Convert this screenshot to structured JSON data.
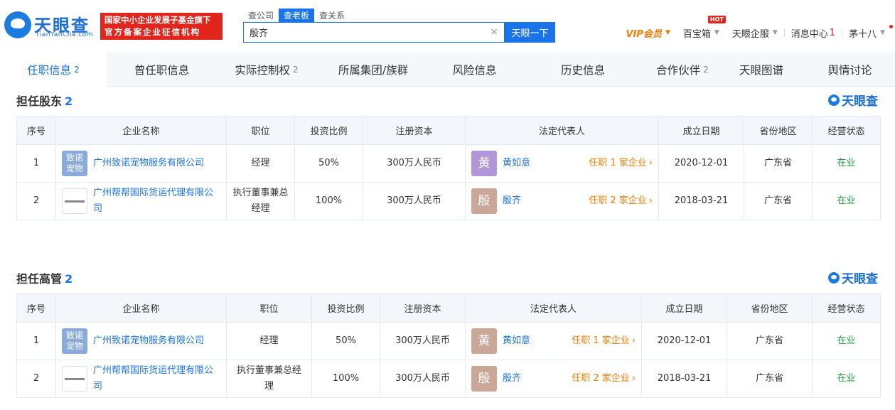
{
  "header": {
    "logo_text": "天眼查",
    "logo_sub": "TianYanCha.com",
    "slogan_line1": "国家中小企业发展子基金旗下",
    "slogan_line2": "官方备案企业征信机构",
    "search_tabs": [
      "查公司",
      "查老板",
      "查关系"
    ],
    "search_value": "殷齐",
    "search_button": "天眼一下",
    "nav": {
      "vip": "VIP会员",
      "baibaoxiang": "百宝箱",
      "hot": "HOT",
      "qiye": "天眼企服",
      "message": "消息中心",
      "message_count": "1",
      "user": "茅十八"
    }
  },
  "tabs": [
    {
      "label": "任职信息",
      "count": "2"
    },
    {
      "label": "曾任职信息",
      "count": ""
    },
    {
      "label": "实际控制权",
      "count": "2"
    },
    {
      "label": "所属集团/族群",
      "count": ""
    },
    {
      "label": "风险信息",
      "count": ""
    },
    {
      "label": "历史信息",
      "count": ""
    },
    {
      "label": "合作伙伴",
      "count": "2"
    },
    {
      "label": "天眼图谱",
      "count": ""
    },
    {
      "label": "舆情讨论",
      "count": ""
    }
  ],
  "brand": "天眼查",
  "shareholder": {
    "title": "担任股东",
    "count": "2",
    "columns": [
      "序号",
      "企业名称",
      "职位",
      "投资比例",
      "注册资本",
      "法定代表人",
      "成立日期",
      "省份地区",
      "经营状态"
    ],
    "rows": [
      {
        "no": "1",
        "logo": "致诺宠物",
        "company": "广州致诺宠物服务有限公司",
        "position": "经理",
        "ratio": "50%",
        "capital": "300万人民币",
        "avatar": "黄",
        "legal": "黄如意",
        "legal_role": "任职 1 家企业",
        "date": "2020-12-01",
        "region": "广东省",
        "status": "在业"
      },
      {
        "no": "2",
        "logo": "",
        "company": "广州帮帮国际货运代理有限公司",
        "position": "执行董事兼总经理",
        "ratio": "100%",
        "capital": "300万人民币",
        "avatar": "殷",
        "legal": "殷齐",
        "legal_role": "任职 2 家企业",
        "date": "2018-03-21",
        "region": "广东省",
        "status": "在业"
      }
    ]
  },
  "executive": {
    "title": "担任高管",
    "count": "2",
    "columns": [
      "序号",
      "企业名称",
      "职位",
      "投资比例",
      "注册资本",
      "法定代表人",
      "成立日期",
      "省份地区",
      "经营状态"
    ],
    "rows": [
      {
        "no": "1",
        "logo": "致诺宠物",
        "company": "广州致诺宠物服务有限公司",
        "position": "经理",
        "ratio": "50%",
        "capital": "300万人民币",
        "avatar": "黄",
        "legal": "黄如意",
        "legal_role": "任职 1 家企业",
        "date": "2020-12-01",
        "region": "广东省",
        "status": "在业"
      },
      {
        "no": "2",
        "logo": "",
        "company": "广州帮帮国际货运代理有限公司",
        "position": "执行董事兼总经理",
        "ratio": "100%",
        "capital": "300万人民币",
        "avatar": "殷",
        "legal": "殷齐",
        "legal_role": "任职 2 家企业",
        "date": "2018-03-21",
        "region": "广东省",
        "status": "在业"
      }
    ]
  },
  "colors": {
    "accent": "#1a73e8",
    "orange": "#f07c00",
    "green": "#1f9e43",
    "red": "#e2251c"
  }
}
